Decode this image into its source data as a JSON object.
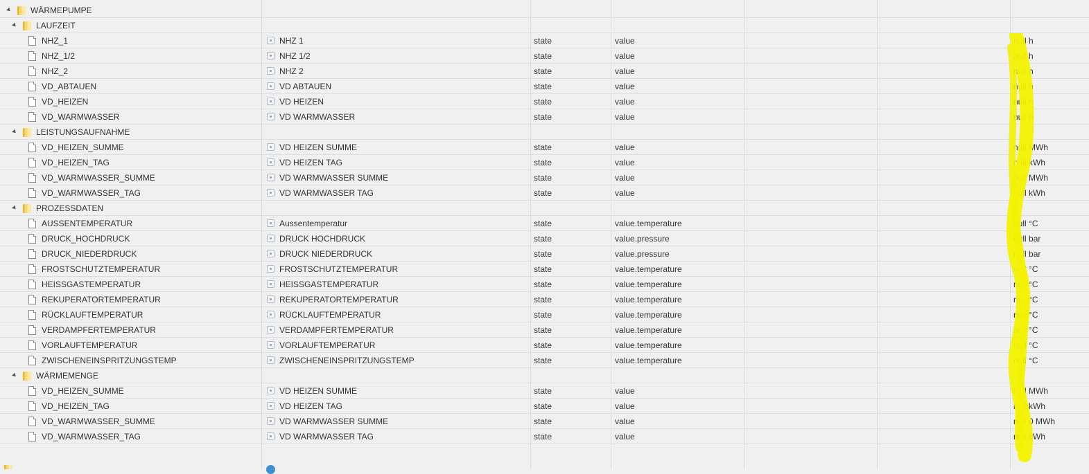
{
  "colors": {
    "highlight": "#f2f200",
    "folder": "#f7d872"
  },
  "tree": [
    {
      "kind": "folder",
      "level": 0,
      "id": "WÄRMEPUMPE"
    },
    {
      "kind": "folder",
      "level": 1,
      "id": "LAUFZEIT"
    },
    {
      "kind": "state",
      "id": "NHZ_1",
      "name": "NHZ 1",
      "type": "state",
      "role": "value",
      "value": "null h"
    },
    {
      "kind": "state",
      "id": "NHZ_1/2",
      "name": "NHZ 1/2",
      "type": "state",
      "role": "value",
      "value": "null h"
    },
    {
      "kind": "state",
      "id": "NHZ_2",
      "name": "NHZ 2",
      "type": "state",
      "role": "value",
      "value": "null h"
    },
    {
      "kind": "state",
      "id": "VD_ABTAUEN",
      "name": "VD ABTAUEN",
      "type": "state",
      "role": "value",
      "value": "null h"
    },
    {
      "kind": "state",
      "id": "VD_HEIZEN",
      "name": "VD HEIZEN",
      "type": "state",
      "role": "value",
      "value": "null h"
    },
    {
      "kind": "state",
      "id": "VD_WARMWASSER",
      "name": "VD WARMWASSER",
      "type": "state",
      "role": "value",
      "value": "null h"
    },
    {
      "kind": "folder",
      "level": 1,
      "id": "LEISTUNGSAUFNAHME"
    },
    {
      "kind": "state",
      "id": "VD_HEIZEN_SUMME",
      "name": "VD HEIZEN SUMME",
      "type": "state",
      "role": "value",
      "value": "null MWh"
    },
    {
      "kind": "state",
      "id": "VD_HEIZEN_TAG",
      "name": "VD HEIZEN TAG",
      "type": "state",
      "role": "value",
      "value": "null kWh"
    },
    {
      "kind": "state",
      "id": "VD_WARMWASSER_SUMME",
      "name": "VD WARMWASSER SUMME",
      "type": "state",
      "role": "value",
      "value": "null MWh"
    },
    {
      "kind": "state",
      "id": "VD_WARMWASSER_TAG",
      "name": "VD WARMWASSER TAG",
      "type": "state",
      "role": "value",
      "value": "null kWh"
    },
    {
      "kind": "folder",
      "level": 1,
      "id": "PROZESSDATEN"
    },
    {
      "kind": "state",
      "id": "AUSSENTEMPERATUR",
      "name": "Aussentemperatur",
      "type": "state",
      "role": "value.temperature",
      "value": "null °C"
    },
    {
      "kind": "state",
      "id": "DRUCK_HOCHDRUCK",
      "name": "DRUCK HOCHDRUCK",
      "type": "state",
      "role": "value.pressure",
      "value": "null bar"
    },
    {
      "kind": "state",
      "id": "DRUCK_NIEDERDRUCK",
      "name": "DRUCK NIEDERDRUCK",
      "type": "state",
      "role": "value.pressure",
      "value": "null bar"
    },
    {
      "kind": "state",
      "id": "FROSTSCHUTZTEMPERATUR",
      "name": "FROSTSCHUTZTEMPERATUR",
      "type": "state",
      "role": "value.temperature",
      "value": "null °C"
    },
    {
      "kind": "state",
      "id": "HEISSGASTEMPERATUR",
      "name": "HEISSGASTEMPERATUR",
      "type": "state",
      "role": "value.temperature",
      "value": "null °C"
    },
    {
      "kind": "state",
      "id": "REKUPERATORTEMPERATUR",
      "name": "REKUPERATORTEMPERATUR",
      "type": "state",
      "role": "value.temperature",
      "value": "null °C"
    },
    {
      "kind": "state",
      "id": "RÜCKLAUFTEMPERATUR",
      "name": "RÜCKLAUFTEMPERATUR",
      "type": "state",
      "role": "value.temperature",
      "value": "null °C"
    },
    {
      "kind": "state",
      "id": "VERDAMPFERTEMPERATUR",
      "name": "VERDAMPFERTEMPERATUR",
      "type": "state",
      "role": "value.temperature",
      "value": "null °C"
    },
    {
      "kind": "state",
      "id": "VORLAUFTEMPERATUR",
      "name": "VORLAUFTEMPERATUR",
      "type": "state",
      "role": "value.temperature",
      "value": "null °C"
    },
    {
      "kind": "state",
      "id": "ZWISCHENEINSPRITZUNGSTEMP",
      "name": "ZWISCHENEINSPRITZUNGSTEMP",
      "type": "state",
      "role": "value.temperature",
      "value": "null °C"
    },
    {
      "kind": "folder",
      "level": 1,
      "id": "WÄRMEMENGE"
    },
    {
      "kind": "state",
      "id": "VD_HEIZEN_SUMME",
      "name": "VD HEIZEN SUMME",
      "type": "state",
      "role": "value",
      "value": "null MWh"
    },
    {
      "kind": "state",
      "id": "VD_HEIZEN_TAG",
      "name": "VD HEIZEN TAG",
      "type": "state",
      "role": "value",
      "value": "null kWh"
    },
    {
      "kind": "state",
      "id": "VD_WARMWASSER_SUMME",
      "name": "VD WARMWASSER SUMME",
      "type": "state",
      "role": "value",
      "value": "null 0 MWh"
    },
    {
      "kind": "state",
      "id": "VD_WARMWASSER_TAG",
      "name": "VD WARMWASSER TAG",
      "type": "state",
      "role": "value",
      "value": "null kWh"
    }
  ]
}
